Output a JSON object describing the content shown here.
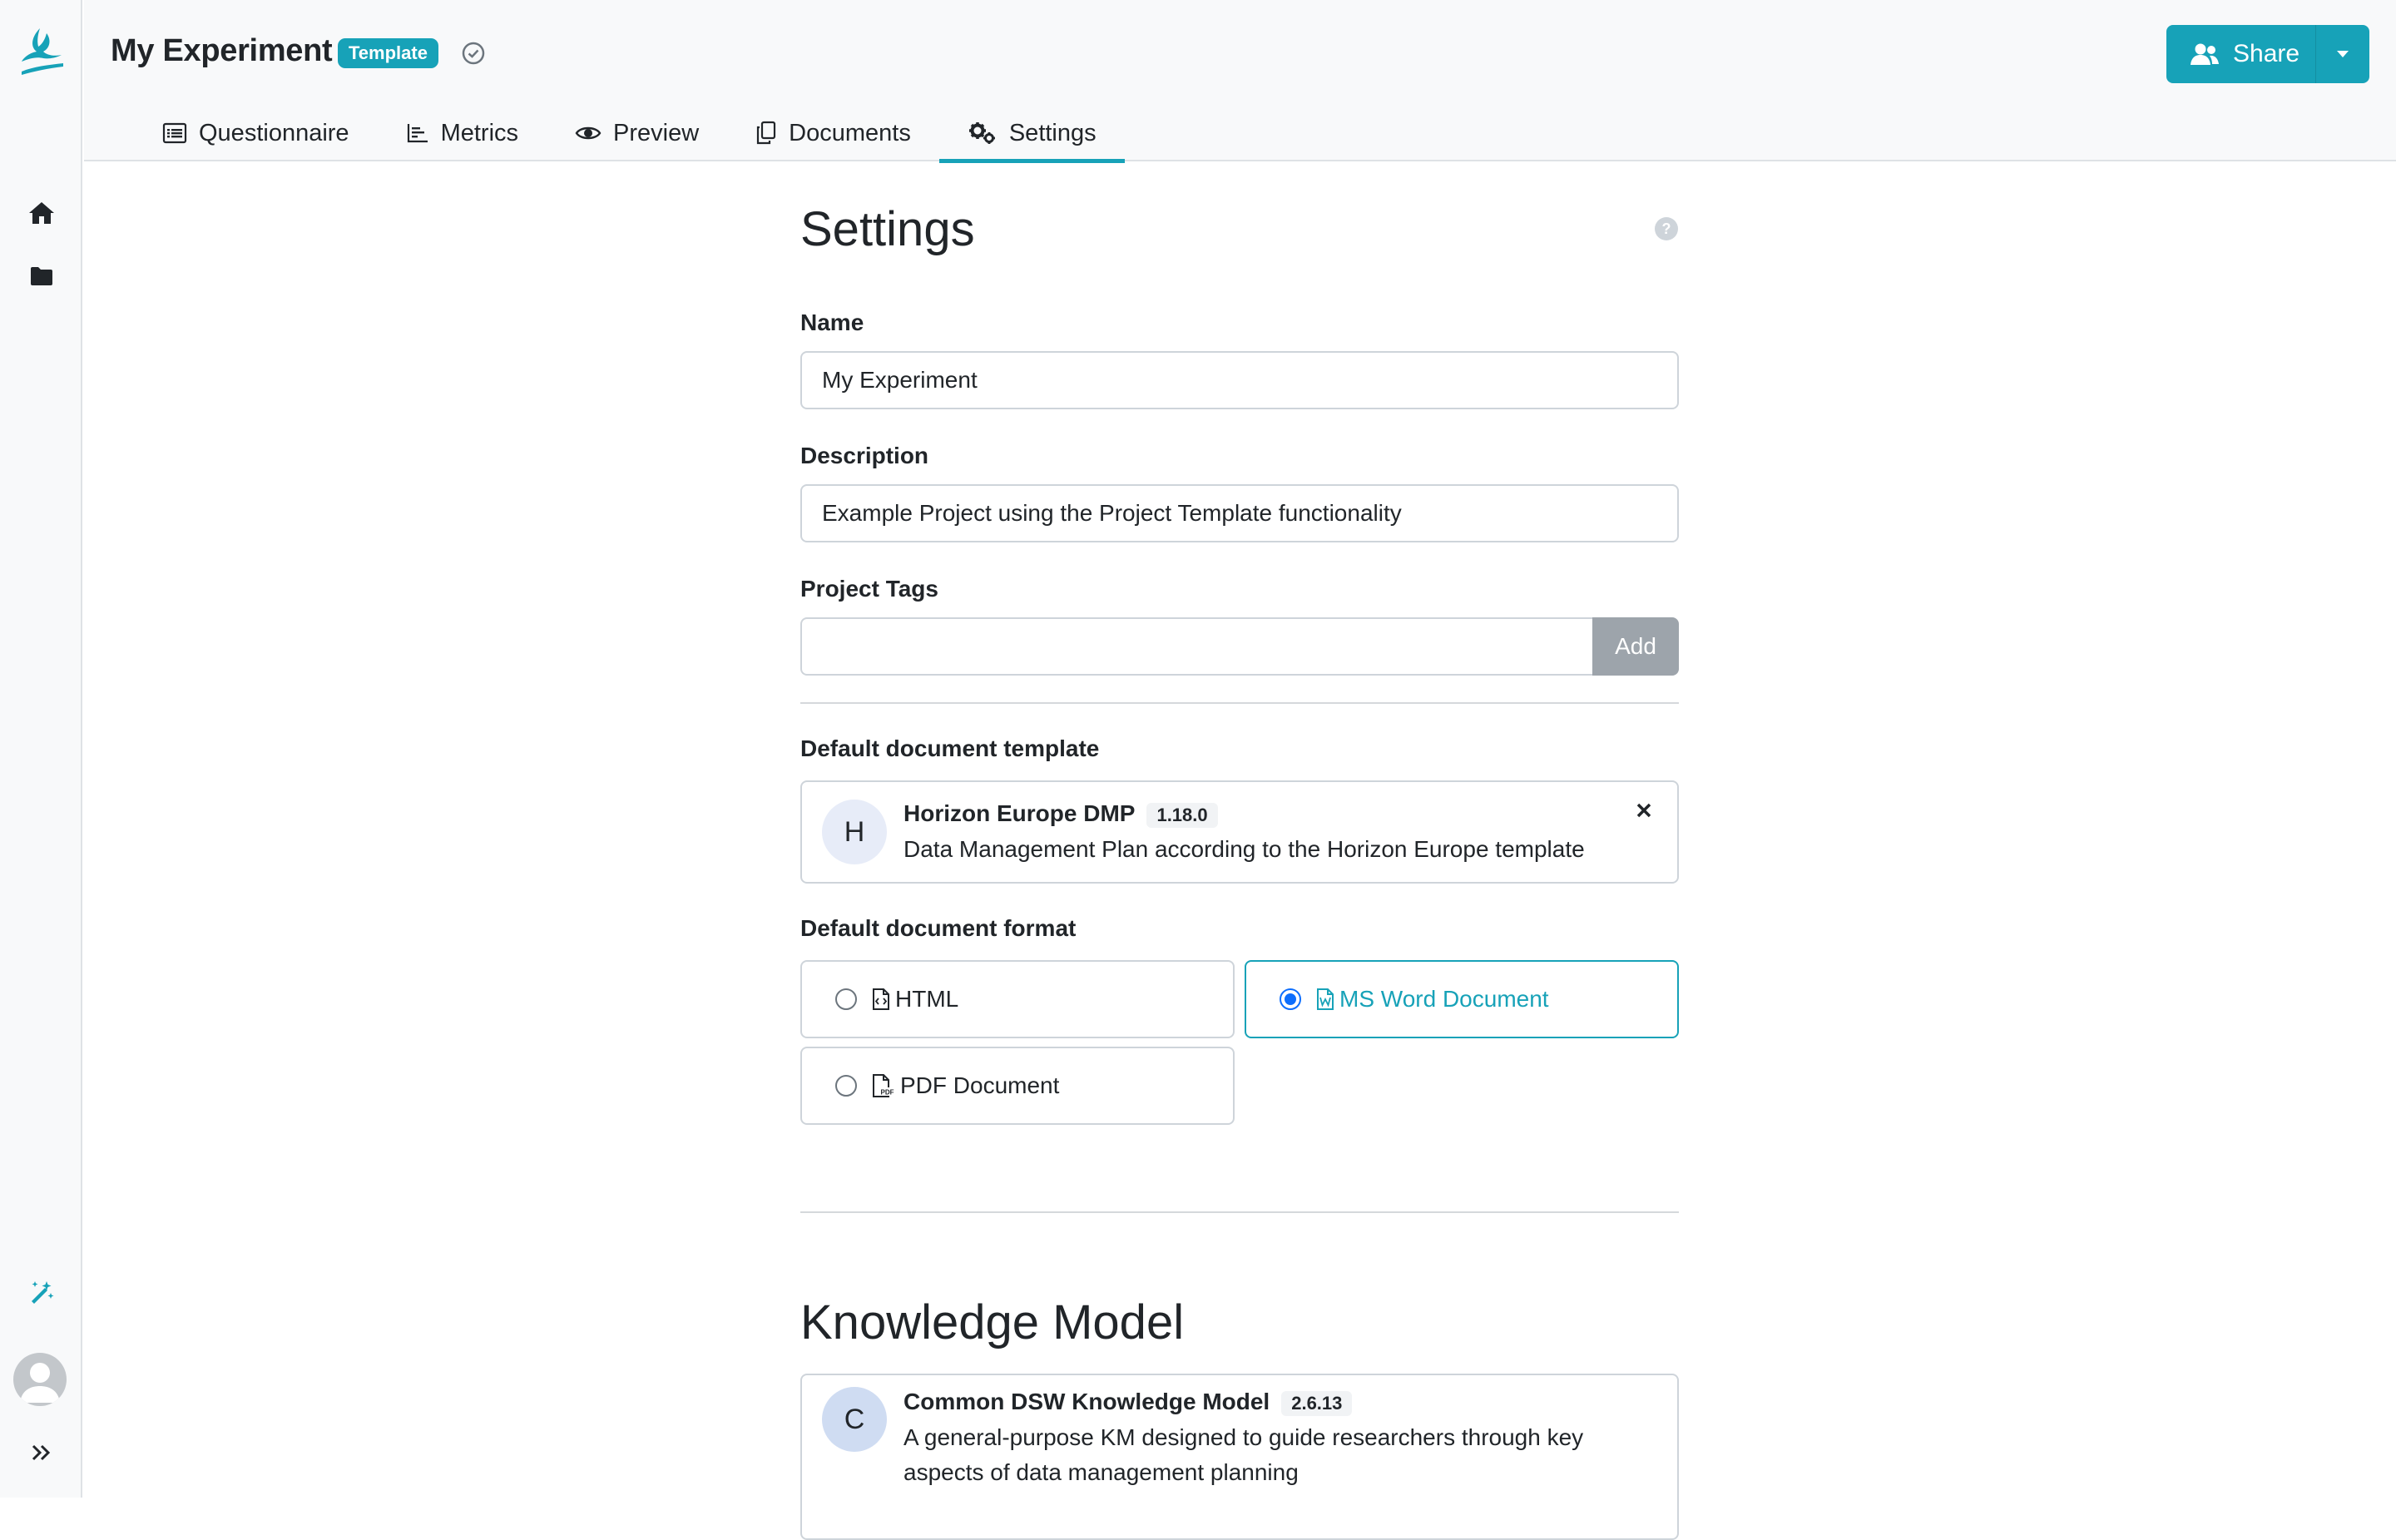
{
  "header": {
    "title": "My Experiment",
    "badge": "Template",
    "share_label": "Share"
  },
  "tabs": [
    {
      "label": "Questionnaire",
      "icon": "list-icon"
    },
    {
      "label": "Metrics",
      "icon": "bar-chart-icon"
    },
    {
      "label": "Preview",
      "icon": "eye-icon"
    },
    {
      "label": "Documents",
      "icon": "copy-icon"
    },
    {
      "label": "Settings",
      "icon": "gears-icon",
      "active": true
    }
  ],
  "settings": {
    "title": "Settings",
    "name_label": "Name",
    "name_value": "My Experiment",
    "description_label": "Description",
    "description_value": "Example Project using the Project Template functionality",
    "tags_label": "Project Tags",
    "tags_value": "",
    "add_label": "Add",
    "template_label": "Default document template",
    "template": {
      "initial": "H",
      "name": "Horizon Europe DMP",
      "version": "1.18.0",
      "description": "Data Management Plan according to the Horizon Europe template"
    },
    "format_label": "Default document format",
    "formats": [
      {
        "label": "HTML",
        "icon": "file-code-icon",
        "selected": false
      },
      {
        "label": "MS Word Document",
        "icon": "file-word-icon",
        "selected": true
      },
      {
        "label": "PDF Document",
        "icon": "file-pdf-icon",
        "selected": false
      }
    ]
  },
  "knowledge_model": {
    "title": "Knowledge Model",
    "initial": "C",
    "name": "Common DSW Knowledge Model",
    "version": "2.6.13",
    "description_line1": "A general-purpose KM designed to guide researchers through key",
    "description_line2": "aspects of data management planning"
  },
  "colors": {
    "accent": "#17a2b8",
    "radio_selected": "#0d6efd",
    "sidebar_bg": "#f8f9fa"
  }
}
